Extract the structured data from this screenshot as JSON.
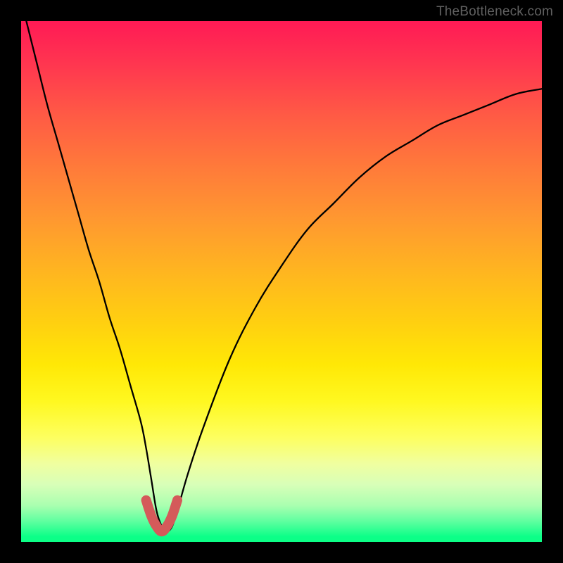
{
  "watermark": "TheBottleneck.com",
  "chart_data": {
    "type": "line",
    "title": "",
    "xlabel": "",
    "ylabel": "",
    "xlim": [
      0,
      100
    ],
    "ylim": [
      0,
      100
    ],
    "series": [
      {
        "name": "main-curve",
        "x": [
          1,
          3,
          5,
          7,
          9,
          11,
          13,
          15,
          17,
          19,
          21,
          23,
          24,
          25,
          26,
          27,
          28,
          29,
          30,
          32,
          35,
          40,
          45,
          50,
          55,
          60,
          65,
          70,
          75,
          80,
          85,
          90,
          95,
          100
        ],
        "values": [
          100,
          92,
          84,
          77,
          70,
          63,
          56,
          50,
          43,
          37,
          30,
          23,
          18,
          12,
          6,
          3,
          2,
          3,
          6,
          13,
          22,
          35,
          45,
          53,
          60,
          65,
          70,
          74,
          77,
          80,
          82,
          84,
          86,
          87
        ]
      },
      {
        "name": "bottom-highlight",
        "x": [
          24,
          25,
          26,
          27,
          28,
          29,
          30
        ],
        "values": [
          8,
          5,
          3,
          2,
          3,
          5,
          8
        ]
      }
    ],
    "background_gradient": {
      "top": "#ff1a55",
      "bottom": "#0cff86"
    },
    "highlight_color": "#d45a5a",
    "curve_color": "#000000"
  }
}
